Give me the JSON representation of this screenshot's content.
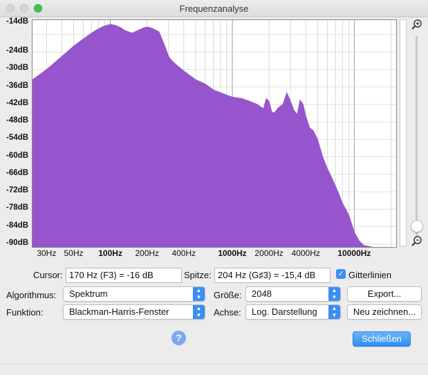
{
  "window": {
    "title": "Frequenzanalyse"
  },
  "chart_data": {
    "type": "area",
    "title": "",
    "xlabel": "",
    "ylabel": "",
    "x_scale": "log",
    "xlim": [
      23,
      22050
    ],
    "ylim": [
      -91,
      -13
    ],
    "grid": true,
    "fill_color": "#9655cc",
    "y_ticks": [
      "-14dB",
      "-24dB",
      "-30dB",
      "-36dB",
      "-42dB",
      "-48dB",
      "-54dB",
      "-60dB",
      "-66dB",
      "-72dB",
      "-78dB",
      "-84dB",
      "-90dB"
    ],
    "x_ticks": [
      "30Hz",
      "50Hz",
      "100Hz",
      "200Hz",
      "400Hz",
      "1000Hz",
      "2000Hz",
      "4000Hz",
      "10000Hz"
    ],
    "x_ticks_bold": [
      "100Hz",
      "1000Hz",
      "10000Hz"
    ],
    "series": [
      {
        "x": [
          23,
          30,
          40,
          50,
          60,
          70,
          80,
          90,
          100,
          110,
          120,
          130,
          150,
          170,
          190,
          204,
          220,
          250,
          280,
          300,
          320,
          350,
          400,
          500,
          600,
          700,
          800,
          1000,
          1200,
          1400,
          1600,
          1800,
          1900,
          2000,
          2100,
          2200,
          2400,
          2600,
          2800,
          3000,
          3200,
          3400,
          3600,
          3800,
          4000,
          4300,
          4600,
          5000,
          5500,
          6000,
          6500,
          7000,
          7500,
          8000,
          8500,
          9000,
          9500,
          10000,
          11000,
          12000,
          14000
        ],
        "y": [
          -33.5,
          -30,
          -25.5,
          -22,
          -19.5,
          -17.5,
          -16,
          -15,
          -14.5,
          -14.8,
          -15.5,
          -16.5,
          -17.5,
          -16.5,
          -15.6,
          -15.4,
          -15.8,
          -17,
          -22,
          -25.5,
          -27,
          -28.5,
          -30.5,
          -33.5,
          -35,
          -37,
          -38,
          -39.5,
          -40,
          -41,
          -42,
          -43.5,
          -40,
          -41,
          -44.5,
          -45,
          -43,
          -42,
          -38,
          -41,
          -44,
          -45.5,
          -40.5,
          -42,
          -46,
          -50,
          -51,
          -54,
          -60,
          -64,
          -67,
          -70,
          -73,
          -76,
          -78,
          -80,
          -83,
          -86,
          -89,
          -90.5,
          -91
        ]
      }
    ]
  },
  "controls": {
    "cursor_label": "Cursor:",
    "cursor_value": "170 Hz (F3) = -16 dB",
    "peak_label": "Spitze:",
    "peak_value": "204 Hz (G♯3) = -15,4 dB",
    "grid_label": "Gitterlinien",
    "grid_checked": true,
    "algorithm_label": "Algorithmus:",
    "algorithm_value": "Spektrum",
    "size_label": "Größe:",
    "size_value": "2048",
    "export_button": "Export...",
    "function_label": "Funktion:",
    "function_value": "Blackman-Harris-Fenster",
    "axis_label": "Achse:",
    "axis_value": "Log. Darstellung",
    "redraw_button": "Neu zeichnen...",
    "help_button": "?",
    "close_button": "Schließen"
  }
}
